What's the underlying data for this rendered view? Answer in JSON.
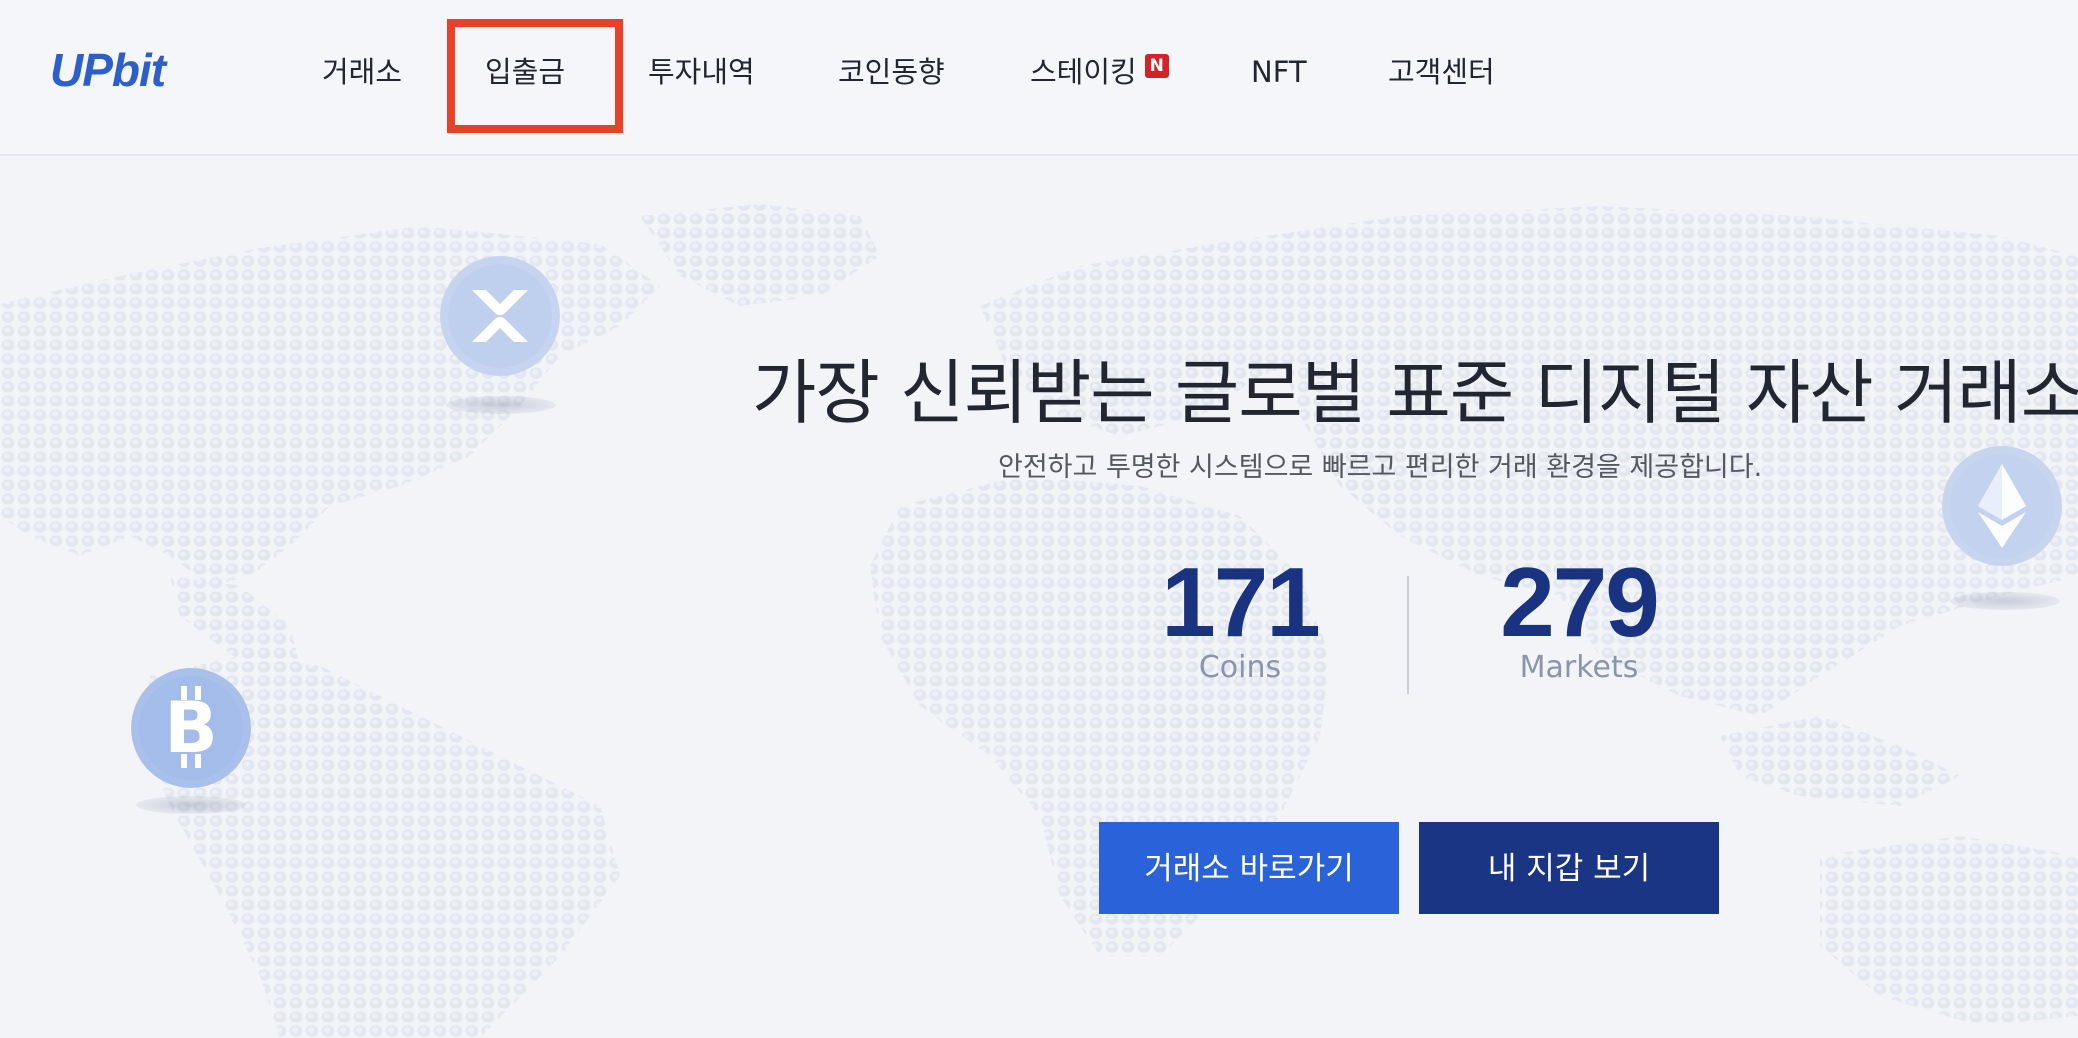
{
  "header": {
    "logo_text": "UPbit",
    "nav": [
      {
        "label": "거래소"
      },
      {
        "label": "입출금"
      },
      {
        "label": "투자내역"
      },
      {
        "label": "코인동향"
      },
      {
        "label": "스테이킹",
        "badge": "N"
      },
      {
        "label": "NFT"
      },
      {
        "label": "고객센터"
      }
    ]
  },
  "hero": {
    "title": "가장 신뢰받는 글로벌 표준 디지털 자산 거래소",
    "subtitle": "안전하고 투명한 시스템으로 빠르고 편리한 거래 환경을 제공합니다.",
    "stats": [
      {
        "value": "171",
        "label": "Coins"
      },
      {
        "value": "279",
        "label": "Markets"
      }
    ],
    "buttons": {
      "exchange": "거래소 바로가기",
      "wallet": "내 지갑 보기"
    }
  },
  "coins": [
    {
      "icon": "xrp-coin-icon"
    },
    {
      "icon": "ethereum-coin-icon"
    },
    {
      "icon": "bitcoin-coin-icon"
    }
  ],
  "colors": {
    "brand_blue": "#1a3380",
    "button_primary": "#2962d9",
    "button_secondary": "#1b3585",
    "highlight_box": "#e8412a",
    "badge_red": "#d2232a",
    "background": "#f3f4f8"
  }
}
